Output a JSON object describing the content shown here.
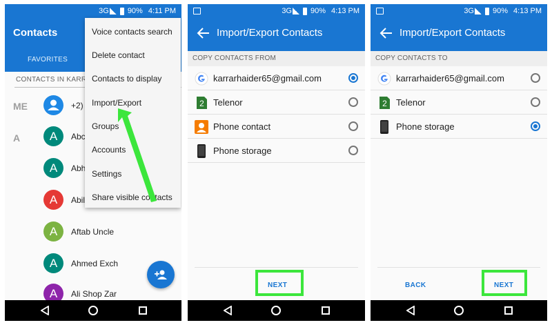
{
  "status": {
    "panel1": {
      "network": "3G",
      "battery": "90%",
      "time": "4:11 PM"
    },
    "panel2": {
      "network": "3G",
      "battery": "90%",
      "time": "4:13 PM"
    },
    "panel3": {
      "network": "3G",
      "battery": "90%",
      "time": "4:13 PM"
    }
  },
  "panel1": {
    "title": "Contacts",
    "tab": "FAVORITES",
    "group_header": "CONTACTS IN KARRA",
    "letters": {
      "me": "ME",
      "a": "A"
    },
    "me_contact": {
      "initial": "",
      "name": "+2)"
    },
    "contacts": [
      {
        "initial": "A",
        "name": "Abc",
        "color": "#00897b"
      },
      {
        "initial": "A",
        "name": "Abh",
        "color": "#00897b"
      },
      {
        "initial": "A",
        "name": "Abil",
        "color": "#e53935"
      },
      {
        "initial": "A",
        "name": "Aftab Uncle",
        "color": "#7cb342"
      },
      {
        "initial": "A",
        "name": "Ahmed Exch",
        "color": "#00897b"
      },
      {
        "initial": "A",
        "name": "Ali Shop Zar",
        "color": "#8e24aa"
      }
    ],
    "menu": [
      "Voice contacts search",
      "Delete contact",
      "Contacts to display",
      "Import/Export",
      "Groups",
      "Accounts",
      "Settings",
      "Share visible contacts"
    ],
    "accent_arrow": "#3ce63c"
  },
  "panel2": {
    "title": "Import/Export Contacts",
    "section": "COPY CONTACTS FROM",
    "items": [
      {
        "label": "karrarhaider65@gmail.com",
        "icon": "google-icon",
        "checked": true
      },
      {
        "label": "Telenor",
        "icon": "sim-2-icon",
        "checked": false
      },
      {
        "label": "Phone contact",
        "icon": "phone-contact-icon",
        "checked": false
      },
      {
        "label": "Phone storage",
        "icon": "phone-storage-icon",
        "checked": false
      }
    ],
    "next": "NEXT"
  },
  "panel3": {
    "title": "Import/Export Contacts",
    "section": "COPY CONTACTS TO",
    "items": [
      {
        "label": "karrarhaider65@gmail.com",
        "icon": "google-icon",
        "checked": false
      },
      {
        "label": "Telenor",
        "icon": "sim-2-icon",
        "checked": false
      },
      {
        "label": "Phone storage",
        "icon": "phone-storage-icon",
        "checked": true
      }
    ],
    "back": "BACK",
    "next": "NEXT"
  },
  "colors": {
    "primary": "#1976d2",
    "highlight": "#3ce63c",
    "sim": "#2e7d32",
    "contact_icon": "#f57c00"
  }
}
